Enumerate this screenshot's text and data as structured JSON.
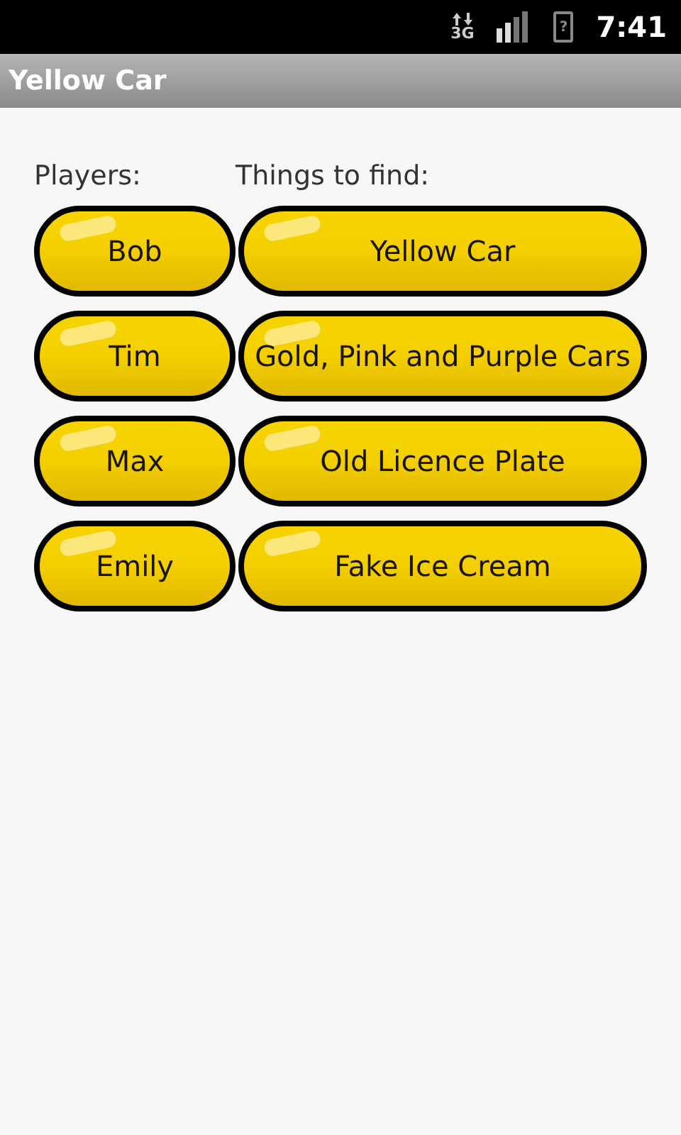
{
  "status_bar": {
    "network": "3G",
    "battery": "?",
    "time": "7:41"
  },
  "window": {
    "title": "Yellow Car"
  },
  "headers": {
    "players": "Players:",
    "things": "Things to find:"
  },
  "rows": [
    {
      "player": "Bob",
      "thing": "Yellow Car"
    },
    {
      "player": "Tim",
      "thing": "Gold, Pink and Purple Cars"
    },
    {
      "player": "Max",
      "thing": "Old Licence Plate"
    },
    {
      "player": "Emily",
      "thing": "Fake Ice Cream"
    }
  ]
}
